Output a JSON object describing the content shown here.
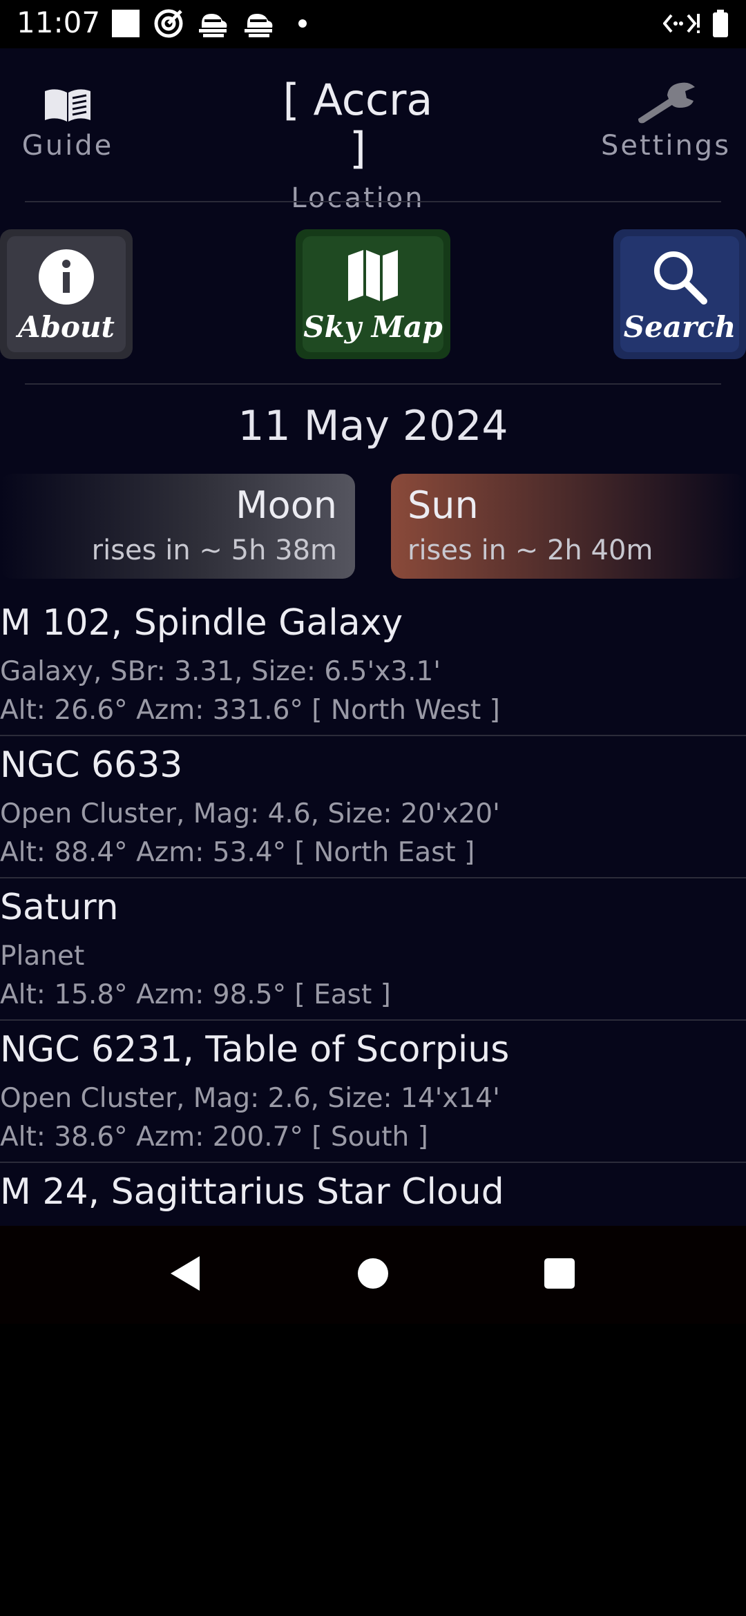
{
  "status_bar": {
    "time": "11:07",
    "icons_left": [
      "square-icon",
      "target-icon",
      "cloud-fog-icon",
      "cloud-fog-icon",
      "dot-icon"
    ],
    "icons_right": [
      "network-code-icon",
      "battery-icon"
    ]
  },
  "top_nav": {
    "guide_label": "Guide",
    "location_title": "[ Accra ]",
    "location_label": "Location",
    "settings_label": "Settings"
  },
  "actions": {
    "about_label": "About",
    "skymap_label": "Sky Map",
    "search_label": "Search"
  },
  "date": "11 May 2024",
  "moon": {
    "title": "Moon",
    "subtitle": "rises in ~ 5h 38m"
  },
  "sun": {
    "title": "Sun",
    "subtitle": "rises in ~ 2h 40m"
  },
  "objects": [
    {
      "name": "M 102, Spindle Galaxy",
      "desc": "Galaxy, SBr: 3.31, Size: 6.5'x3.1'",
      "pos": "Alt: 26.6° Azm: 331.6° [ North West ]"
    },
    {
      "name": "NGC 6633",
      "desc": "Open Cluster, Mag: 4.6, Size: 20'x20'",
      "pos": "Alt: 88.4° Azm: 53.4° [ North East ]"
    },
    {
      "name": "Saturn",
      "desc": "Planet",
      "pos": "Alt: 15.8° Azm: 98.5° [ East ]"
    },
    {
      "name": "NGC 6231, Table of Scorpius",
      "desc": "Open Cluster, Mag: 2.6, Size: 14'x14'",
      "pos": "Alt: 38.6° Azm: 200.7° [ South ]"
    },
    {
      "name": "M 24, Sagittarius Star Cloud",
      "desc": "",
      "pos": ""
    }
  ],
  "colors": {
    "app_background": "#06061a",
    "about_button": "#3a3a44",
    "skymap_button": "#1f4a22",
    "search_button": "#23356e",
    "moon_card_accent": "#555560",
    "sun_card_accent": "#8a4a3a"
  },
  "system_nav": {
    "back_icon": "back-triangle-icon",
    "home_icon": "home-circle-icon",
    "recents_icon": "recents-square-icon"
  }
}
